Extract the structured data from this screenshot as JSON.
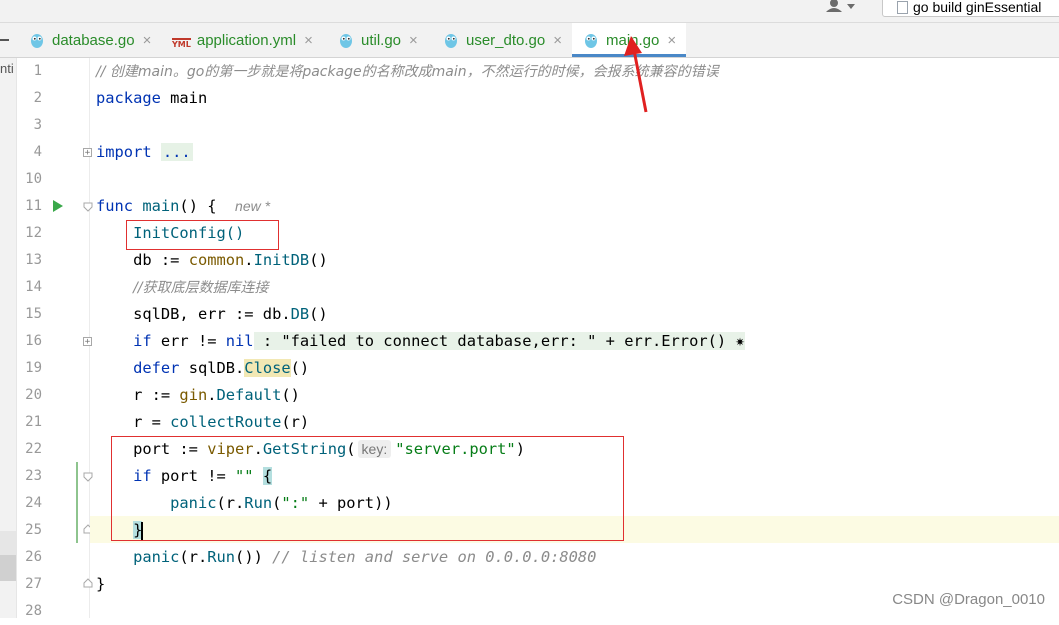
{
  "run_config": {
    "label": "go build ginEssential"
  },
  "tabs": [
    {
      "label": "database.go",
      "icon": "go-gopher-icon"
    },
    {
      "label": "application.yml",
      "icon": "yml-file-icon",
      "badge": "YML"
    },
    {
      "label": "util.go",
      "icon": "go-gopher-icon"
    },
    {
      "label": "user_dto.go",
      "icon": "go-gopher-icon"
    },
    {
      "label": "main.go",
      "icon": "go-gopher-icon",
      "active": true
    }
  ],
  "tab_close_glyph": "×",
  "left_strip_text": "nti",
  "line_numbers": [
    "1",
    "2",
    "3",
    "4",
    "10",
    "11",
    "12",
    "13",
    "14",
    "15",
    "16",
    "19",
    "20",
    "21",
    "22",
    "23",
    "24",
    "25",
    "26",
    "27",
    "28"
  ],
  "code": {
    "l1": "// 创建main。go的第一步就是将package的名称改成main，不然运行的时候，会报系统兼容的错误",
    "l2_kw": "package",
    "l2_name": " main",
    "l4_kw": "import",
    "l4_fold": "...",
    "l11_kw": "func",
    "l11_fn": " main",
    "l11_rest": "() {",
    "l11_hint": "new *",
    "l12": "InitConfig()",
    "l13_a": "db := ",
    "l13_pkg": "common",
    "l13_dot": ".",
    "l13_fn": "InitDB",
    "l13_end": "()",
    "l14": "//获取底层数据库连接",
    "l15_a": "sqlDB, err := db.",
    "l15_fn": "DB",
    "l15_end": "()",
    "l16_kw": "if",
    "l16_a": " err != ",
    "l16_nil": "nil",
    "l16_fold": " : \"failed to connect database,err: \" + err.Error() ✷",
    "l19_kw": "defer",
    "l19_a": " sqlDB.",
    "l19_fn": "Close",
    "l19_end": "()",
    "l20_a": "r := ",
    "l20_pkg": "gin",
    "l20_dot": ".",
    "l20_fn": "Default",
    "l20_end": "()",
    "l21_a": "r = ",
    "l21_fn": "collectRoute",
    "l21_end": "(r)",
    "l22_a": "port := ",
    "l22_pkg": "viper",
    "l22_dot": ".",
    "l22_fn": "GetString",
    "l22_open": "(",
    "l22_hint": "key:",
    "l22_str": "\"server.port\"",
    "l22_end": ")",
    "l23_kw": "if",
    "l23_a": " port != ",
    "l23_str": "\"\"",
    "l23_sp": " ",
    "l23_brace": "{",
    "l24_fn": "panic",
    "l24_a": "(r.",
    "l24_run": "Run",
    "l24_b": "(",
    "l24_str": "\":\"",
    "l24_c": " + port))",
    "l25": "}",
    "l26_fn": "panic",
    "l26_a": "(r.",
    "l26_run": "Run",
    "l26_b": "()) ",
    "l26_cm": "// listen and serve on 0.0.0.0:8080",
    "l27": "}"
  },
  "watermark": "CSDN @Dragon_0010",
  "colors": {
    "annotation_red": "#e03030",
    "tab_green": "#2a8c2a",
    "active_tab_underline": "#4a88c7"
  }
}
